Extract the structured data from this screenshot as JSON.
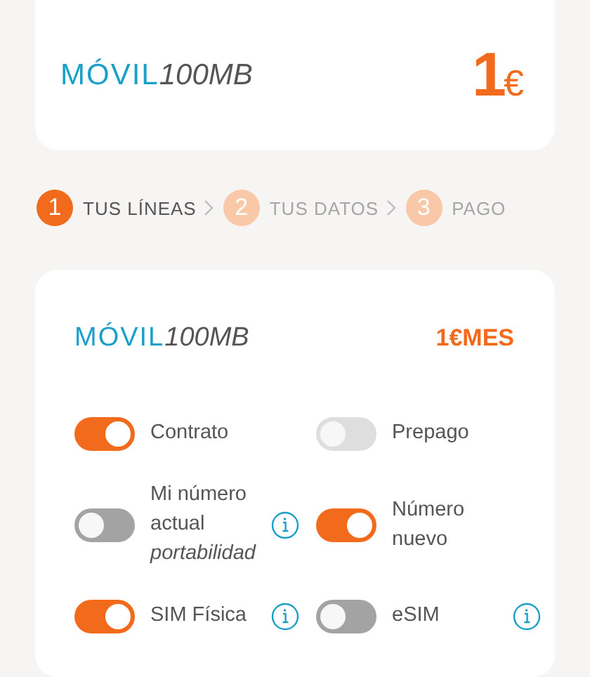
{
  "summary": {
    "brand": "MÓVIL",
    "plan": "100MB",
    "price_amount": "1",
    "price_currency": "€"
  },
  "steps": [
    {
      "number": "1",
      "label": "TUS LÍNEAS",
      "selected": true
    },
    {
      "number": "2",
      "label": "TUS DATOS",
      "selected": false
    },
    {
      "number": "3",
      "label": "PAGO",
      "selected": false
    }
  ],
  "line_card": {
    "brand": "MÓVIL",
    "plan": "100MB",
    "price": "1€MES",
    "options": [
      {
        "kind": "plain",
        "label": "Contrato",
        "on": true,
        "disabled": false
      },
      {
        "kind": "plain",
        "label": "Prepago",
        "on": false,
        "disabled": true
      },
      {
        "kind": "info",
        "label": "Mi número actual",
        "note": "portabilidad",
        "on": false,
        "disabled": false
      },
      {
        "kind": "plain",
        "label": "Número nuevo",
        "on": true,
        "disabled": false
      },
      {
        "kind": "info",
        "label": "SIM Física",
        "on": true,
        "disabled": false
      },
      {
        "kind": "info",
        "label": "eSIM",
        "on": false,
        "disabled": false
      }
    ]
  }
}
